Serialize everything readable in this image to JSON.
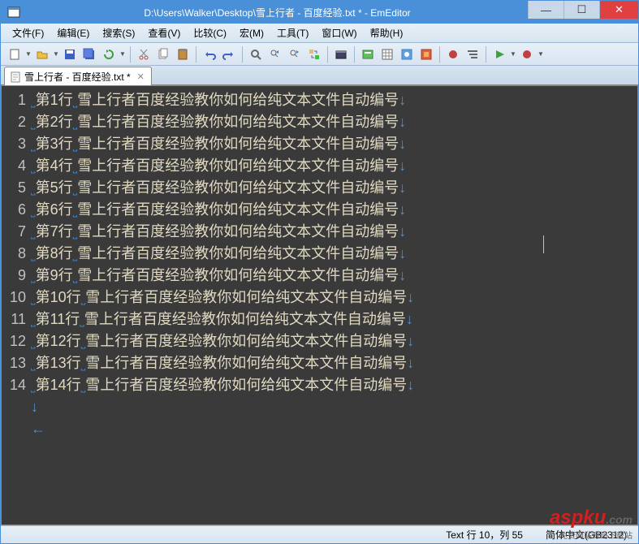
{
  "title": "D:\\Users\\Walker\\Desktop\\雪上行者 - 百度经验.txt * - EmEditor",
  "menus": [
    {
      "label": "文件(F)"
    },
    {
      "label": "编辑(E)"
    },
    {
      "label": "搜索(S)"
    },
    {
      "label": "查看(V)"
    },
    {
      "label": "比较(C)"
    },
    {
      "label": "宏(M)"
    },
    {
      "label": "工具(T)"
    },
    {
      "label": "窗口(W)"
    },
    {
      "label": "帮助(H)"
    }
  ],
  "tab": {
    "label": "雪上行者 - 百度经验.txt *"
  },
  "lines": [
    {
      "n": "1",
      "t": "第1行 雪上行者百度经验教你如何给纯文本文件自动编号"
    },
    {
      "n": "2",
      "t": "第2行 雪上行者百度经验教你如何给纯文本文件自动编号"
    },
    {
      "n": "3",
      "t": "第3行 雪上行者百度经验教你如何给纯文本文件自动编号"
    },
    {
      "n": "4",
      "t": "第4行 雪上行者百度经验教你如何给纯文本文件自动编号"
    },
    {
      "n": "5",
      "t": "第5行 雪上行者百度经验教你如何给纯文本文件自动编号"
    },
    {
      "n": "6",
      "t": "第6行 雪上行者百度经验教你如何给纯文本文件自动编号"
    },
    {
      "n": "7",
      "t": "第7行 雪上行者百度经验教你如何给纯文本文件自动编号"
    },
    {
      "n": "8",
      "t": "第8行 雪上行者百度经验教你如何给纯文本文件自动编号"
    },
    {
      "n": "9",
      "t": "第9行 雪上行者百度经验教你如何给纯文本文件自动编号"
    },
    {
      "n": "10",
      "t": "第10行 雪上行者百度经验教你如何给纯文本文件自动编号"
    },
    {
      "n": "11",
      "t": "第11行 雪上行者百度经验教你如何给纯文本文件自动编号"
    },
    {
      "n": "12",
      "t": "第12行 雪上行者百度经验教你如何给纯文本文件自动编号"
    },
    {
      "n": "13",
      "t": "第13行 雪上行者百度经验教你如何给纯文本文件自动编号"
    },
    {
      "n": "14",
      "t": "第14行 雪上行者百度经验教你如何给纯文本文件自动编号"
    }
  ],
  "status": {
    "pos": "Text  行 10，列 55",
    "enc": "简体中文(GB2312)"
  },
  "watermark": {
    "brand": "aspku",
    "tld": ".com",
    "sub": "免费网站源码下载站"
  }
}
